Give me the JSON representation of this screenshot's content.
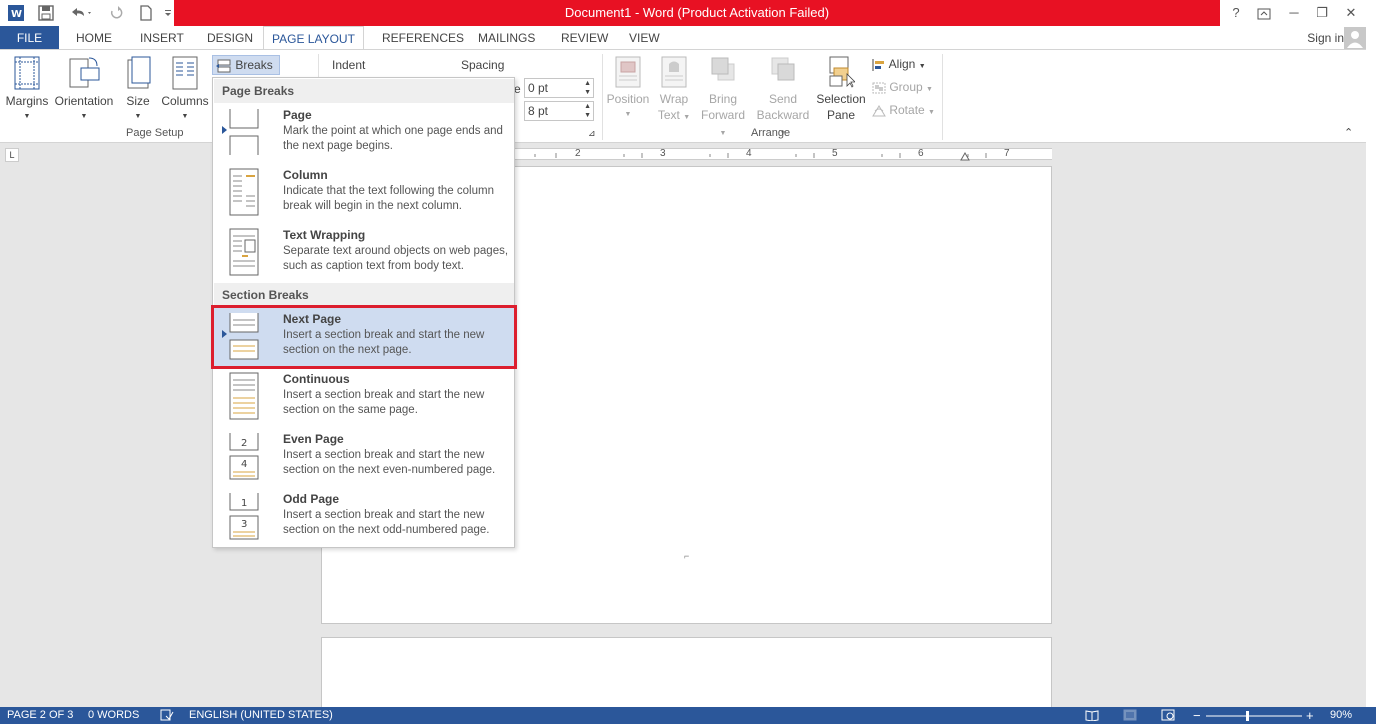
{
  "window": {
    "title": "Document1 -  Word (Product Activation Failed)",
    "help": "?",
    "minimize": "─",
    "restore": "❐",
    "close": "✕"
  },
  "tabs": [
    {
      "label": "FILE"
    },
    {
      "label": "HOME"
    },
    {
      "label": "INSERT"
    },
    {
      "label": "DESIGN"
    },
    {
      "label": "PAGE LAYOUT"
    },
    {
      "label": "REFERENCES"
    },
    {
      "label": "MAILINGS"
    },
    {
      "label": "REVIEW"
    },
    {
      "label": "VIEW"
    }
  ],
  "active_tab": "PAGE LAYOUT",
  "signin": "Sign in",
  "ribbon": {
    "page_setup": {
      "margins": "Margins",
      "orientation": "Orientation",
      "size": "Size",
      "columns": "Columns",
      "breaks": "Breaks",
      "group_label": "Page Setup"
    },
    "paragraph": {
      "indent": "Indent",
      "spacing": "Spacing",
      "before_value": "0 pt",
      "after_value": "8 pt",
      "before_label": "e"
    },
    "arrange": {
      "position": "Position",
      "wrap_text_1": "Wrap",
      "wrap_text_2": "Text",
      "bring_forward_1": "Bring",
      "bring_forward_2": "Forward",
      "send_backward_1": "Send",
      "send_backward_2": "Backward",
      "selection_pane_1": "Selection",
      "selection_pane_2": "Pane",
      "align": "Align",
      "group": "Group",
      "rotate": "Rotate",
      "group_label": "Arrange"
    }
  },
  "ruler": {
    "marks": [
      "2",
      "3",
      "4",
      "5",
      "6",
      "7"
    ]
  },
  "breaks_menu": {
    "page_breaks_header": "Page Breaks",
    "section_breaks_header": "Section Breaks",
    "items": [
      {
        "title": "Page",
        "desc": "Mark the point at which one page ends and the next page begins."
      },
      {
        "title": "Column",
        "desc": "Indicate that the text following the column break will begin in the next column."
      },
      {
        "title": "Text Wrapping",
        "desc": "Separate text around objects on web pages, such as caption text from body text."
      },
      {
        "title": "Next Page",
        "desc": "Insert a section break and start the new section on the next page."
      },
      {
        "title": "Continuous",
        "desc": "Insert a section break and start the new section on the same page."
      },
      {
        "title": "Even Page",
        "desc": "Insert a section break and start the new section on the next even-numbered page."
      },
      {
        "title": "Odd Page",
        "desc": "Insert a section break and start the new section on the next odd-numbered page."
      }
    ]
  },
  "status": {
    "page": "PAGE 2 OF 3",
    "words": "0 WORDS",
    "language": "ENGLISH (UNITED STATES)",
    "zoom": "90%",
    "zoom_minus": "−",
    "zoom_plus": "+"
  },
  "colors": {
    "accent": "#2b579a",
    "title_bar_red": "#e81123",
    "highlight_outline": "#dc1e2e",
    "selected_bg": "#cfdcf0"
  }
}
